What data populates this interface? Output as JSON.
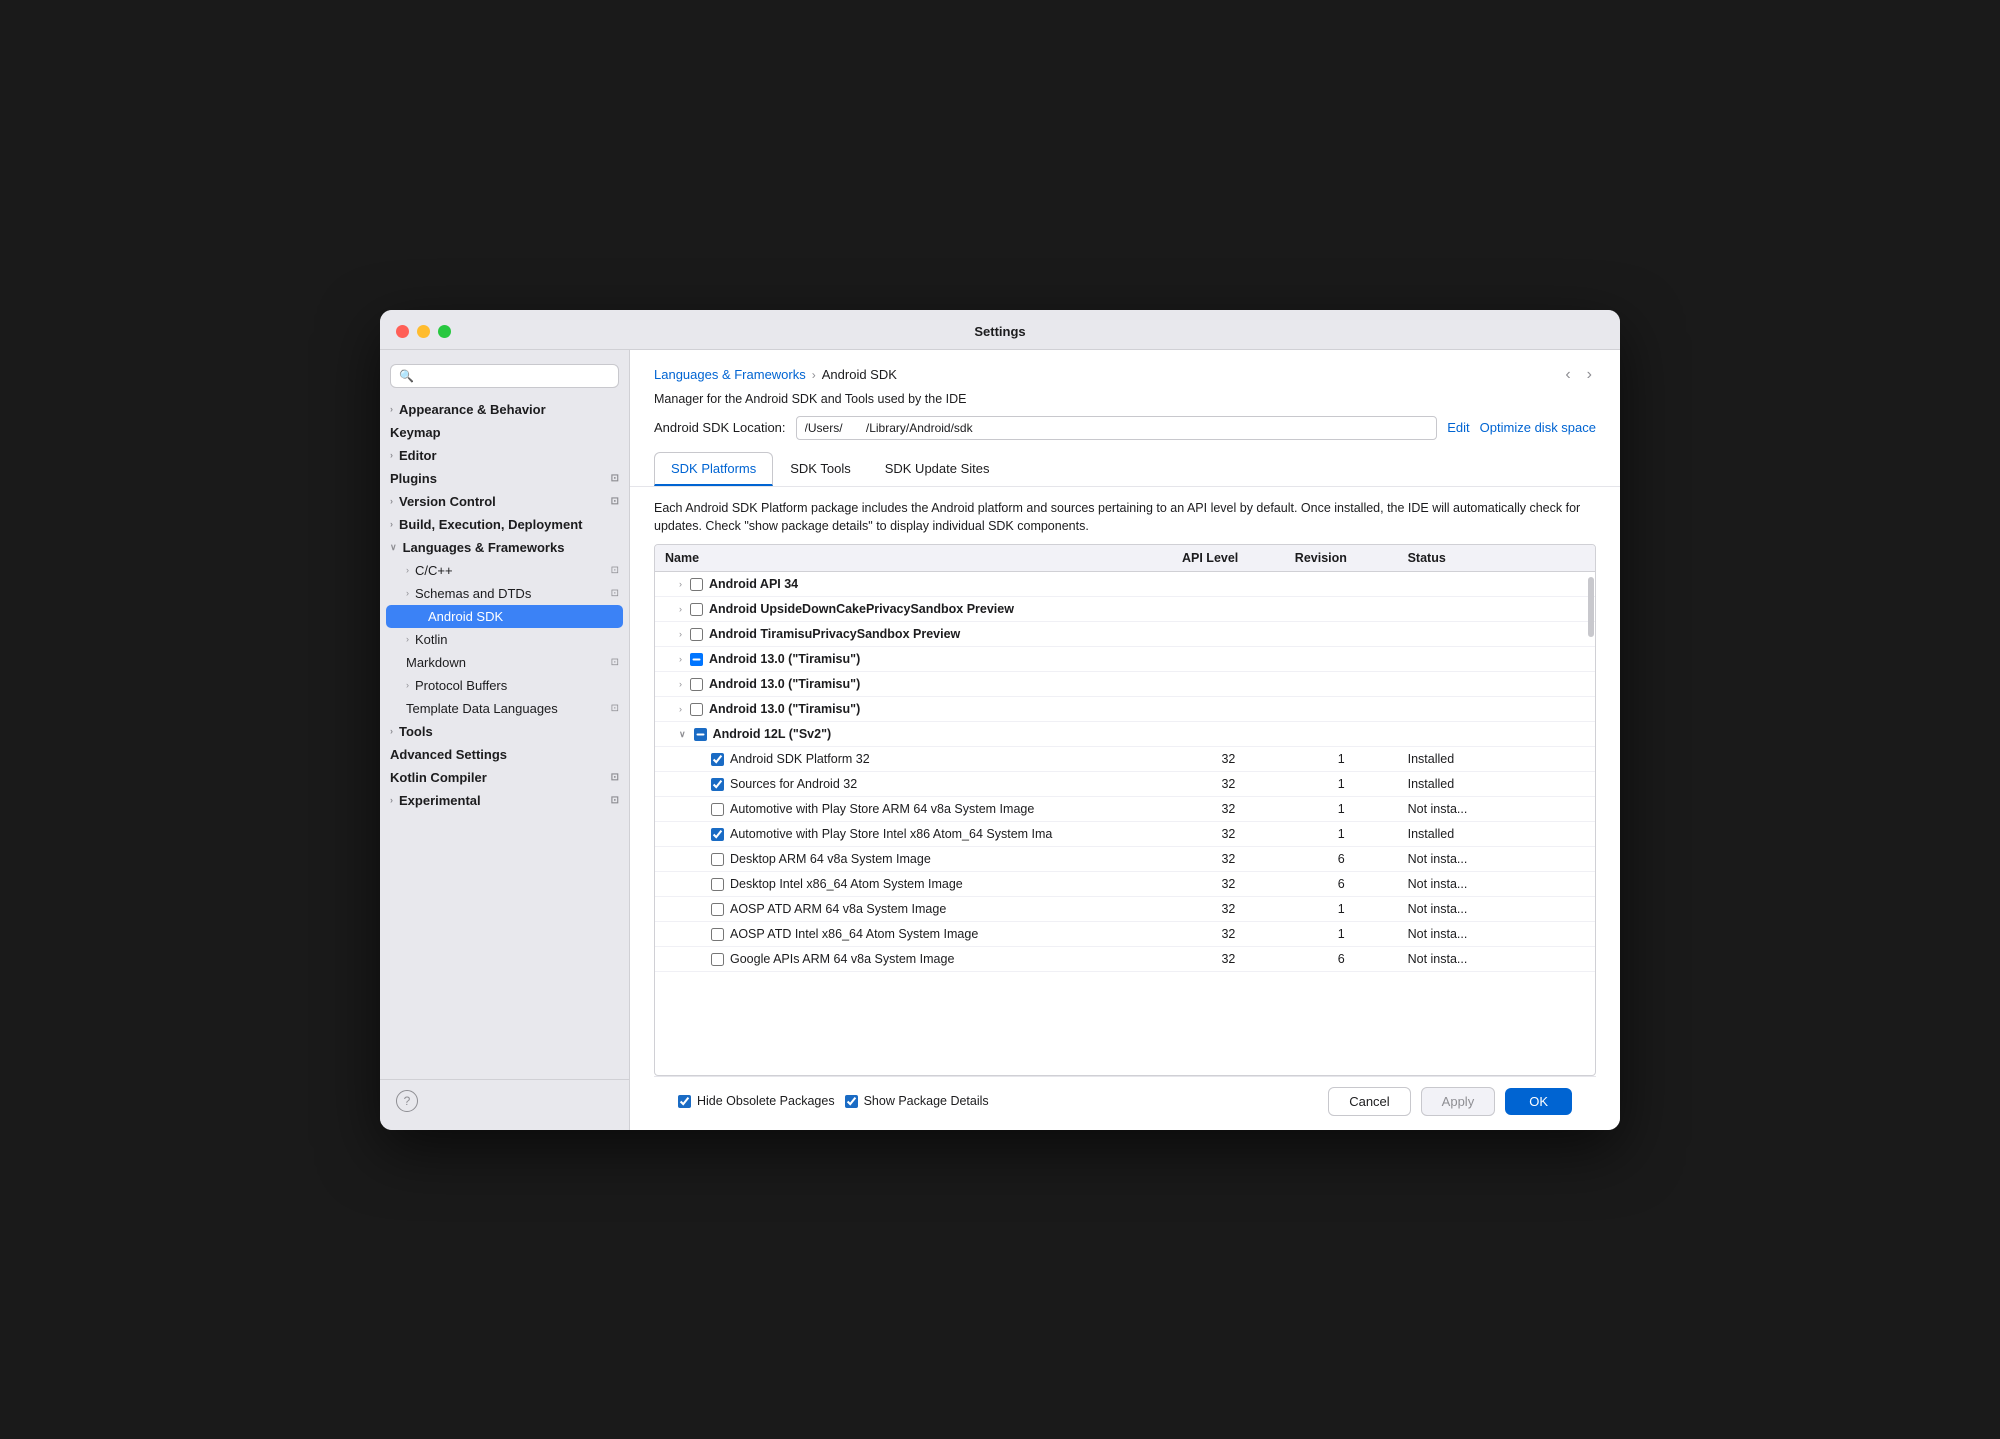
{
  "window": {
    "title": "Settings"
  },
  "sidebar": {
    "search_placeholder": "🔍",
    "items": [
      {
        "id": "appearance",
        "label": "Appearance & Behavior",
        "indent": 0,
        "hasChevron": true,
        "bold": true,
        "badge": ""
      },
      {
        "id": "keymap",
        "label": "Keymap",
        "indent": 0,
        "hasChevron": false,
        "bold": true,
        "badge": ""
      },
      {
        "id": "editor",
        "label": "Editor",
        "indent": 0,
        "hasChevron": true,
        "bold": true,
        "badge": ""
      },
      {
        "id": "plugins",
        "label": "Plugins",
        "indent": 0,
        "hasChevron": false,
        "bold": true,
        "badge": "⊡"
      },
      {
        "id": "version-control",
        "label": "Version Control",
        "indent": 0,
        "hasChevron": true,
        "bold": true,
        "badge": "⊡"
      },
      {
        "id": "build-execution",
        "label": "Build, Execution, Deployment",
        "indent": 0,
        "hasChevron": true,
        "bold": true,
        "badge": ""
      },
      {
        "id": "languages",
        "label": "Languages & Frameworks",
        "indent": 0,
        "hasChevron": true,
        "bold": true,
        "expanded": true,
        "badge": ""
      },
      {
        "id": "cpp",
        "label": "C/C++",
        "indent": 1,
        "hasChevron": true,
        "bold": false,
        "badge": "⊡"
      },
      {
        "id": "schemas",
        "label": "Schemas and DTDs",
        "indent": 1,
        "hasChevron": true,
        "bold": false,
        "badge": "⊡"
      },
      {
        "id": "android-sdk",
        "label": "Android SDK",
        "indent": 2,
        "hasChevron": false,
        "bold": false,
        "active": true,
        "badge": ""
      },
      {
        "id": "kotlin",
        "label": "Kotlin",
        "indent": 1,
        "hasChevron": true,
        "bold": false,
        "badge": ""
      },
      {
        "id": "markdown",
        "label": "Markdown",
        "indent": 1,
        "hasChevron": false,
        "bold": false,
        "badge": "⊡"
      },
      {
        "id": "protocol-buffers",
        "label": "Protocol Buffers",
        "indent": 1,
        "hasChevron": true,
        "bold": false,
        "badge": ""
      },
      {
        "id": "template-data",
        "label": "Template Data Languages",
        "indent": 1,
        "hasChevron": false,
        "bold": false,
        "badge": "⊡"
      },
      {
        "id": "tools",
        "label": "Tools",
        "indent": 0,
        "hasChevron": true,
        "bold": true,
        "badge": ""
      },
      {
        "id": "advanced-settings",
        "label": "Advanced Settings",
        "indent": 0,
        "hasChevron": false,
        "bold": true,
        "badge": ""
      },
      {
        "id": "kotlin-compiler",
        "label": "Kotlin Compiler",
        "indent": 0,
        "hasChevron": false,
        "bold": true,
        "badge": "⊡"
      },
      {
        "id": "experimental",
        "label": "Experimental",
        "indent": 0,
        "hasChevron": true,
        "bold": true,
        "badge": "⊡"
      }
    ]
  },
  "breadcrumb": {
    "parent": "Languages & Frameworks",
    "separator": "›",
    "current": "Android SDK"
  },
  "main": {
    "sdk_info": "Manager for the Android SDK and Tools used by the IDE",
    "location_label": "Android SDK Location:",
    "location_value": "/Users/       /Library/Android/sdk",
    "edit_label": "Edit",
    "optimize_label": "Optimize disk space",
    "tabs": [
      {
        "id": "sdk-platforms",
        "label": "SDK Platforms",
        "active": true
      },
      {
        "id": "sdk-tools",
        "label": "SDK Tools",
        "active": false
      },
      {
        "id": "sdk-update-sites",
        "label": "SDK Update Sites",
        "active": false
      }
    ],
    "description": "Each Android SDK Platform package includes the Android platform and sources pertaining to an API level by default. Once installed, the IDE will automatically check for updates. Check \"show package details\" to display individual SDK components.",
    "table": {
      "columns": [
        "Name",
        "API Level",
        "Revision",
        "Status"
      ],
      "rows": [
        {
          "id": "r1",
          "indent": 1,
          "chevron": "›",
          "checkbox": false,
          "checkState": "unchecked",
          "name": "Android API 34",
          "api": "",
          "revision": "",
          "status": "",
          "bold": true
        },
        {
          "id": "r2",
          "indent": 1,
          "chevron": "›",
          "checkbox": true,
          "checkState": "unchecked",
          "name": "Android UpsideDownCakePrivacySandbox Preview",
          "api": "",
          "revision": "",
          "status": "",
          "bold": true
        },
        {
          "id": "r3",
          "indent": 1,
          "chevron": "›",
          "checkbox": true,
          "checkState": "unchecked",
          "name": "Android TiramisuPrivacySandbox Preview",
          "api": "",
          "revision": "",
          "status": "",
          "bold": true
        },
        {
          "id": "r4",
          "indent": 1,
          "chevron": "›",
          "checkbox": true,
          "checkState": "indeterminate",
          "name": "Android 13.0 (\"Tiramisu\")",
          "api": "",
          "revision": "",
          "status": "",
          "bold": true
        },
        {
          "id": "r5",
          "indent": 1,
          "chevron": "›",
          "checkbox": true,
          "checkState": "unchecked",
          "name": "Android 13.0 (\"Tiramisu\")",
          "api": "",
          "revision": "",
          "status": "",
          "bold": true
        },
        {
          "id": "r6",
          "indent": 1,
          "chevron": "›",
          "checkbox": true,
          "checkState": "unchecked",
          "name": "Android 13.0 (\"Tiramisu\")",
          "api": "",
          "revision": "",
          "status": "",
          "bold": true
        },
        {
          "id": "r7",
          "indent": 1,
          "chevron": "∨",
          "checkbox": true,
          "checkState": "indeterminate",
          "name": "Android 12L (\"Sv2\")",
          "api": "",
          "revision": "",
          "status": "",
          "bold": true,
          "expanded": true
        },
        {
          "id": "r8",
          "indent": 2,
          "chevron": "",
          "checkbox": true,
          "checkState": "checked",
          "name": "Android SDK Platform 32",
          "api": "32",
          "revision": "1",
          "status": "Installed",
          "bold": false
        },
        {
          "id": "r9",
          "indent": 2,
          "chevron": "",
          "checkbox": true,
          "checkState": "checked",
          "name": "Sources for Android 32",
          "api": "32",
          "revision": "1",
          "status": "Installed",
          "bold": false
        },
        {
          "id": "r10",
          "indent": 2,
          "chevron": "",
          "checkbox": true,
          "checkState": "unchecked",
          "name": "Automotive with Play Store ARM 64 v8a System Image",
          "api": "32",
          "revision": "1",
          "status": "Not insta...",
          "bold": false
        },
        {
          "id": "r11",
          "indent": 2,
          "chevron": "",
          "checkbox": true,
          "checkState": "checked",
          "name": "Automotive with Play Store Intel x86 Atom_64 System Ima",
          "api": "32",
          "revision": "1",
          "status": "Installed",
          "bold": false
        },
        {
          "id": "r12",
          "indent": 2,
          "chevron": "",
          "checkbox": true,
          "checkState": "unchecked",
          "name": "Desktop ARM 64 v8a System Image",
          "api": "32",
          "revision": "6",
          "status": "Not insta...",
          "bold": false
        },
        {
          "id": "r13",
          "indent": 2,
          "chevron": "",
          "checkbox": true,
          "checkState": "unchecked",
          "name": "Desktop Intel x86_64 Atom System Image",
          "api": "32",
          "revision": "6",
          "status": "Not insta...",
          "bold": false
        },
        {
          "id": "r14",
          "indent": 2,
          "chevron": "",
          "checkbox": true,
          "checkState": "unchecked",
          "name": "AOSP ATD ARM 64 v8a System Image",
          "api": "32",
          "revision": "1",
          "status": "Not insta...",
          "bold": false
        },
        {
          "id": "r15",
          "indent": 2,
          "chevron": "",
          "checkbox": true,
          "checkState": "unchecked",
          "name": "AOSP ATD Intel x86_64 Atom System Image",
          "api": "32",
          "revision": "1",
          "status": "Not insta...",
          "bold": false
        },
        {
          "id": "r16",
          "indent": 2,
          "chevron": "",
          "checkbox": true,
          "checkState": "unchecked",
          "name": "Google APIs ARM 64 v8a System Image",
          "api": "32",
          "revision": "6",
          "status": "Not insta...",
          "bold": false
        }
      ]
    },
    "footer": {
      "hide_obsolete_checked": true,
      "hide_obsolete_label": "Hide Obsolete Packages",
      "show_details_checked": true,
      "show_details_label": "Show Package Details",
      "cancel_label": "Cancel",
      "apply_label": "Apply",
      "ok_label": "OK"
    }
  }
}
